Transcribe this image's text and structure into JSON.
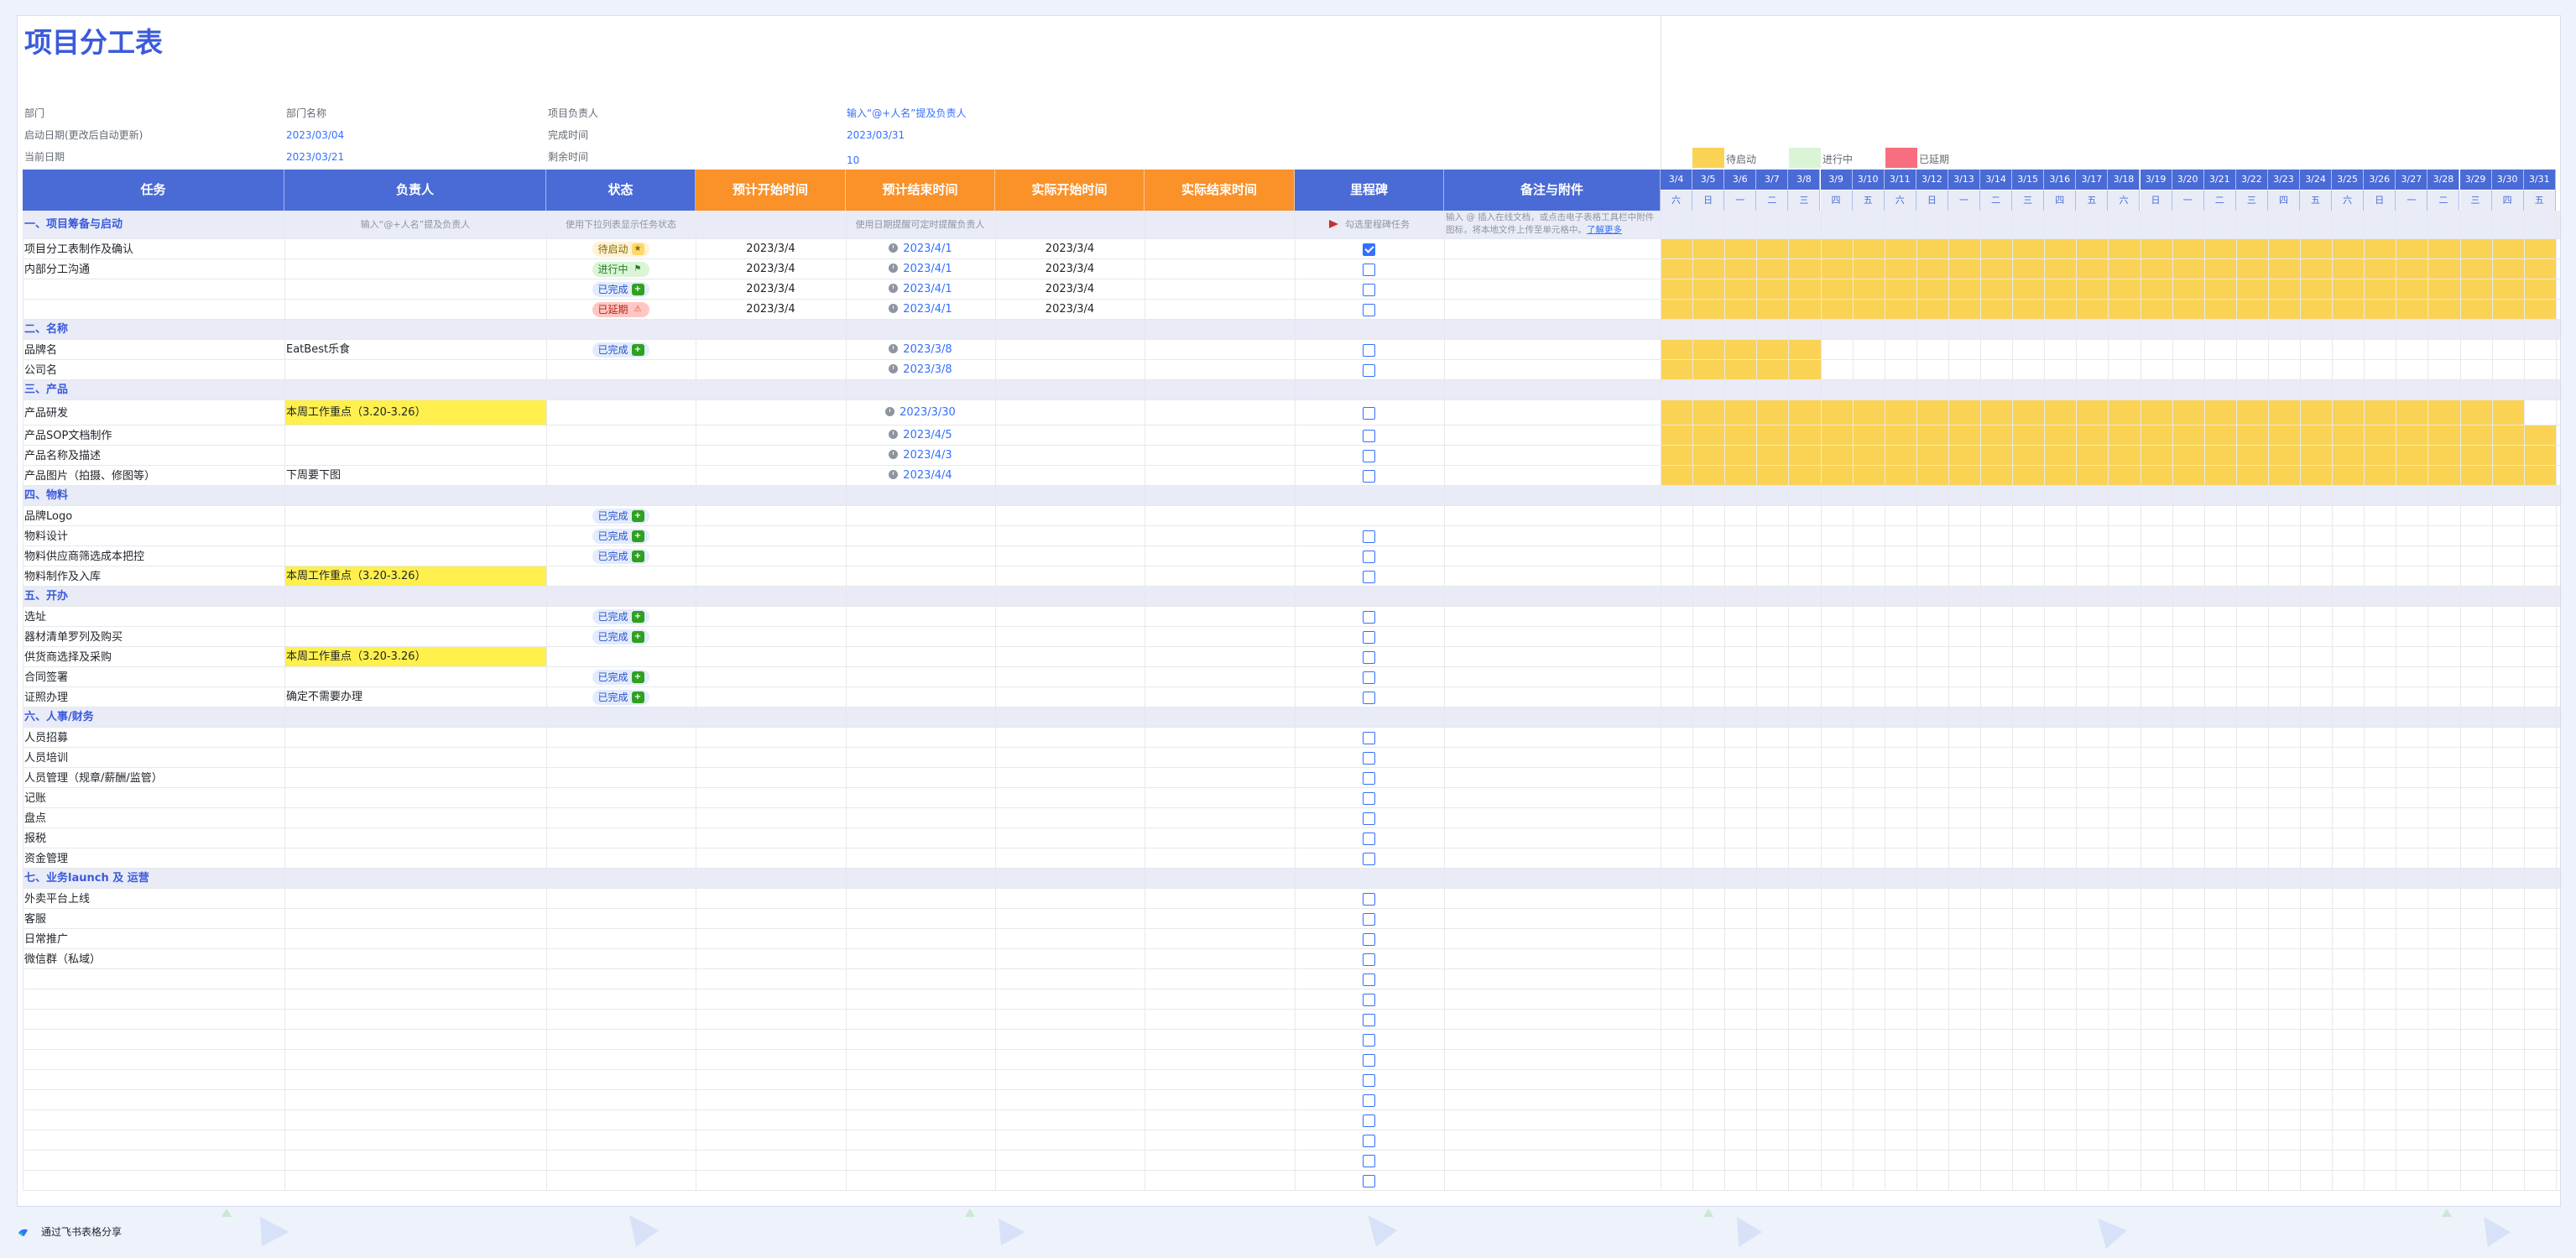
{
  "title": "项目分工表",
  "info": {
    "dept_label": "部门",
    "dept_value": "部门名称",
    "owner_label": "项目负责人",
    "owner_value": "输入“@+人名”提及负责人",
    "start_label": "启动日期(更改后自动更新)",
    "start_value": "2023/03/04",
    "finish_label": "完成时间",
    "finish_value": "2023/03/31",
    "today_label": "当前日期",
    "today_value": "2023/03/21",
    "remain_label": "剩余时间",
    "remain_value": "10"
  },
  "legend": [
    {
      "label": "待启动",
      "color": "#fad355"
    },
    {
      "label": "进行中",
      "color": "#d9f5d6"
    },
    {
      "label": "已延期",
      "color": "#f76e7e"
    }
  ],
  "headers": {
    "task": "任务",
    "owner": "负责人",
    "status": "状态",
    "plan_start": "预计开始时间",
    "plan_end": "预计结束时间",
    "actual_start": "实际开始时间",
    "actual_end": "实际结束时间",
    "milestone": "里程碑",
    "notes": "备注与附件"
  },
  "dates": [
    "3/4",
    "3/5",
    "3/6",
    "3/7",
    "3/8",
    "3/9",
    "3/10",
    "3/11",
    "3/12",
    "3/13",
    "3/14",
    "3/15",
    "3/16",
    "3/17",
    "3/18",
    "3/19",
    "3/20",
    "3/21",
    "3/22",
    "3/23",
    "3/24",
    "3/25",
    "3/26",
    "3/27",
    "3/28",
    "3/29",
    "3/30",
    "3/31"
  ],
  "weekdays": [
    "六",
    "日",
    "一",
    "二",
    "三",
    "四",
    "五",
    "六",
    "日",
    "一",
    "二",
    "三",
    "四",
    "五",
    "六",
    "日",
    "一",
    "二",
    "三",
    "四",
    "五",
    "六",
    "日",
    "一",
    "二",
    "三",
    "四",
    "五"
  ],
  "hints": {
    "owner": "输入“@+人名”提及负责人",
    "status": "使用下拉列表显示任务状态",
    "date": "使用日期提醒可定时提醒负责人",
    "milestone": "勾选里程碑任务",
    "notes_1": "输入 @ 插入在线文档，或点击电子表格工具栏中",
    "notes_2": "附件图标，将本地文件上传至单元格中。",
    "notes_link": "了解更多"
  },
  "rows": [
    {
      "type": "section",
      "task": "一、项目筹备与启动",
      "hints": true
    },
    {
      "task": "项目分工表制作及确认",
      "status": "待启动",
      "status_kind": "pending",
      "status_icon": "★",
      "plan_start": "2023/3/4",
      "plan_end": "2023/4/1",
      "actual_start": "2023/3/4",
      "milestone": "checked",
      "bar": [
        0,
        28
      ]
    },
    {
      "task": "内部分工沟通",
      "status": "进行中",
      "status_kind": "going",
      "status_icon": "⚑",
      "plan_start": "2023/3/4",
      "plan_end": "2023/4/1",
      "actual_start": "2023/3/4",
      "milestone": "box",
      "bar": [
        0,
        28
      ]
    },
    {
      "task": "",
      "status": "已完成",
      "status_kind": "done",
      "status_icon": "+",
      "plan_start": "2023/3/4",
      "plan_end": "2023/4/1",
      "actual_start": "2023/3/4",
      "milestone": "box",
      "bar": [
        0,
        28
      ]
    },
    {
      "task": "",
      "status": "已延期",
      "status_kind": "late",
      "status_icon": "⚠",
      "plan_start": "2023/3/4",
      "plan_end": "2023/4/1",
      "actual_start": "2023/3/4",
      "milestone": "box",
      "bar": [
        0,
        28
      ]
    },
    {
      "type": "section",
      "task": "二、名称"
    },
    {
      "task": "品牌名",
      "owner": "EatBest乐食",
      "status": "已完成",
      "status_kind": "done",
      "status_icon": "+",
      "plan_end": "2023/3/8",
      "milestone": "box",
      "bar": [
        0,
        5
      ]
    },
    {
      "task": "公司名",
      "plan_end": "2023/3/8",
      "milestone": "box",
      "bar": [
        0,
        5
      ]
    },
    {
      "type": "section",
      "task": "三、产品"
    },
    {
      "task": "产品研发",
      "owner": "本周工作重点（3.20-3.26）",
      "owner_hl": true,
      "plan_end": "2023/3/30",
      "milestone": "box",
      "bar": [
        0,
        27
      ],
      "tall": true
    },
    {
      "task": "产品SOP文档制作",
      "plan_end": "2023/4/5",
      "milestone": "box",
      "bar": [
        0,
        28
      ]
    },
    {
      "task": "产品名称及描述",
      "plan_end": "2023/4/3",
      "milestone": "box",
      "bar": [
        0,
        28
      ]
    },
    {
      "task": "产品图片（拍摄、修图等）",
      "owner": "下周要下图",
      "plan_end": "2023/4/4",
      "milestone": "box",
      "bar": [
        0,
        28
      ]
    },
    {
      "type": "section",
      "task": "四、物料"
    },
    {
      "task": "品牌Logo",
      "status": "已完成",
      "status_kind": "done",
      "status_icon": "+"
    },
    {
      "task": "物料设计",
      "status": "已完成",
      "status_kind": "done",
      "status_icon": "+",
      "milestone": "box"
    },
    {
      "task": "物料供应商筛选成本把控",
      "status": "已完成",
      "status_kind": "done",
      "status_icon": "+",
      "milestone": "box"
    },
    {
      "task": "物料制作及入库",
      "owner": "本周工作重点（3.20-3.26）",
      "owner_hl": true,
      "milestone": "box"
    },
    {
      "type": "section",
      "task": "五、开办"
    },
    {
      "task": "选址",
      "status": "已完成",
      "status_kind": "done",
      "status_icon": "+",
      "milestone": "box"
    },
    {
      "task": "器材清单罗列及购买",
      "status": "已完成",
      "status_kind": "done",
      "status_icon": "+",
      "milestone": "box"
    },
    {
      "task": "供货商选择及采购",
      "owner": "本周工作重点（3.20-3.26）",
      "owner_hl": true,
      "milestone": "box"
    },
    {
      "task": "合同签署",
      "status": "已完成",
      "status_kind": "done",
      "status_icon": "+",
      "milestone": "box"
    },
    {
      "task": "证照办理",
      "owner": "确定不需要办理",
      "status": "已完成",
      "status_kind": "done",
      "status_icon": "+",
      "milestone": "box"
    },
    {
      "type": "section",
      "task": "六、人事/财务"
    },
    {
      "task": "人员招募",
      "milestone": "box"
    },
    {
      "task": "人员培训",
      "milestone": "box"
    },
    {
      "task": "人员管理（规章/薪酬/监管）",
      "milestone": "box"
    },
    {
      "task": "记账",
      "milestone": "box"
    },
    {
      "task": "盘点",
      "milestone": "box"
    },
    {
      "task": "报税",
      "milestone": "box"
    },
    {
      "task": "资金管理",
      "milestone": "box"
    },
    {
      "type": "section",
      "task": "七、业务launch 及 运营"
    },
    {
      "task": "外卖平台上线",
      "milestone": "box"
    },
    {
      "task": "客服",
      "milestone": "box"
    },
    {
      "task": "日常推广",
      "milestone": "box"
    },
    {
      "task": "微信群（私域）",
      "milestone": "box"
    },
    {
      "milestone": "box"
    },
    {
      "milestone": "box"
    },
    {
      "milestone": "box"
    },
    {
      "milestone": "box"
    },
    {
      "milestone": "box"
    },
    {
      "milestone": "box"
    },
    {
      "milestone": "box"
    },
    {
      "milestone": "box"
    },
    {
      "milestone": "box"
    },
    {
      "milestone": "box"
    },
    {
      "milestone": "box"
    }
  ],
  "footer": "通过飞书表格分享"
}
